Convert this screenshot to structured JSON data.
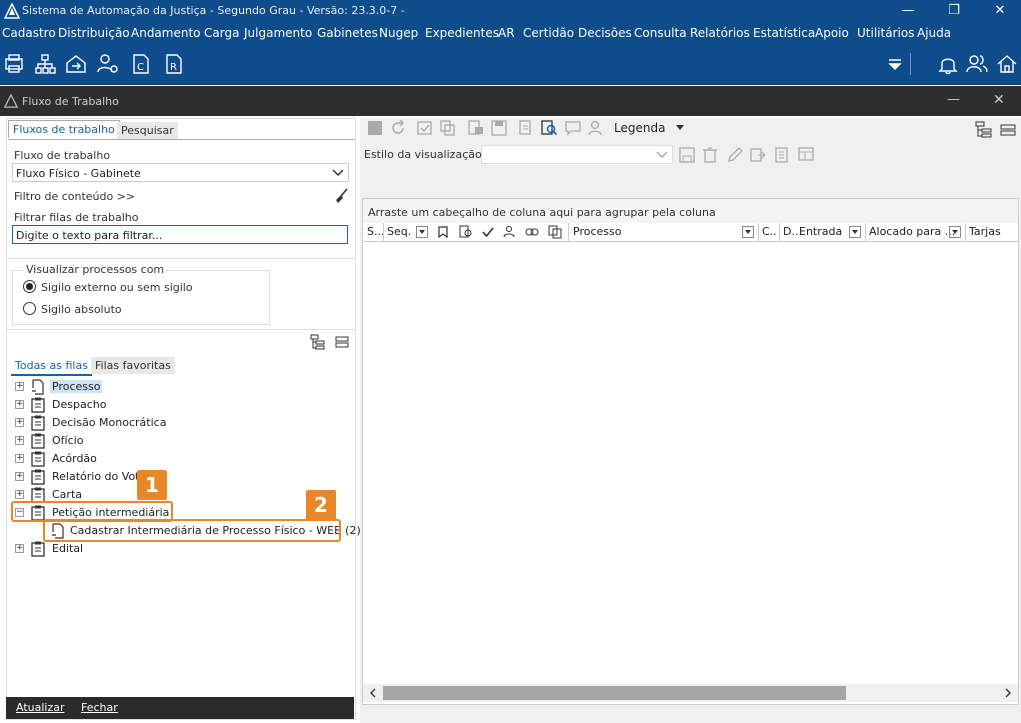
{
  "app": {
    "title": "Sistema de Automação da Justiça - Segundo Grau - Versão: 23.3.0-7 -",
    "window_controls": {
      "minimize": "—",
      "restore": "❐",
      "close": "✕"
    }
  },
  "menu": [
    "Cadastro",
    "Distribuição",
    "Andamento",
    "Carga",
    "Julgamento",
    "Gabinetes",
    "Nugep",
    "Expedientes",
    "AR",
    "Certidão",
    "Decisões",
    "Consulta",
    "Relatórios",
    "Estatística",
    "Apoio",
    "Utilitários",
    "Ajuda"
  ],
  "toolbar": {
    "icons": [
      "printer-icon",
      "network-icon",
      "home-transfer-icon",
      "user-settings-icon",
      "document-c-icon",
      "document-r-icon"
    ],
    "right_icons": [
      "dropdown-arrow-icon",
      "bell-icon",
      "users-icon",
      "home-icon"
    ]
  },
  "window": {
    "title": "Fluxo de Trabalho",
    "minimize": "—",
    "close": "✕"
  },
  "left": {
    "tabs": [
      "Fluxos de trabalho",
      "Pesquisar"
    ],
    "flow_label": "Fluxo de trabalho",
    "flow_value": "Fluxo Físico - Gabinete",
    "content_filter_label": "Filtro de conteúdo >>",
    "filter_queues_label": "Filtrar filas de trabalho",
    "filter_placeholder": "Digite o texto para filtrar...",
    "visualize_label": "Visualizar processos com",
    "radios": [
      {
        "label": "Sigilo externo ou sem sigilo",
        "checked": true
      },
      {
        "label": "Sigilo absoluto",
        "checked": false
      }
    ],
    "queue_tabs": [
      "Todas as filas",
      "Filas favoritas"
    ],
    "tree": [
      {
        "label": "Processo",
        "expander": "+",
        "selected": true
      },
      {
        "label": "Despacho",
        "expander": "+"
      },
      {
        "label": "Decisão Monocrática",
        "expander": "+"
      },
      {
        "label": "Ofício",
        "expander": "+"
      },
      {
        "label": "Acórdão",
        "expander": "+"
      },
      {
        "label": "Relatório do Voto",
        "expander": "+"
      },
      {
        "label": "Carta",
        "expander": "+"
      },
      {
        "label": "Petição intermediária",
        "expander": "−"
      },
      {
        "label": "Cadastrar Intermediária de Processo Físico - WEB (2)",
        "child": true
      },
      {
        "label": "Edital",
        "expander": "+"
      }
    ],
    "callouts": [
      "1",
      "2"
    ],
    "bottom": {
      "refresh": "Atualizar",
      "close": "Fechar"
    }
  },
  "right": {
    "legend_label": "Legenda",
    "view_style_label": "Estilo da visualização",
    "group_hint": "Arraste um cabeçalho de coluna aqui para agrupar pela coluna",
    "columns": [
      "S...",
      "Seq.",
      "Processo",
      "C..",
      "D..",
      "Entrada",
      "Alocado para ...",
      "Tarjas"
    ]
  },
  "colors": {
    "titlebar": "#0f4c8c",
    "window_header": "#2e2e2e",
    "accent": "#1a5fb4",
    "callout": "#e8862a"
  }
}
